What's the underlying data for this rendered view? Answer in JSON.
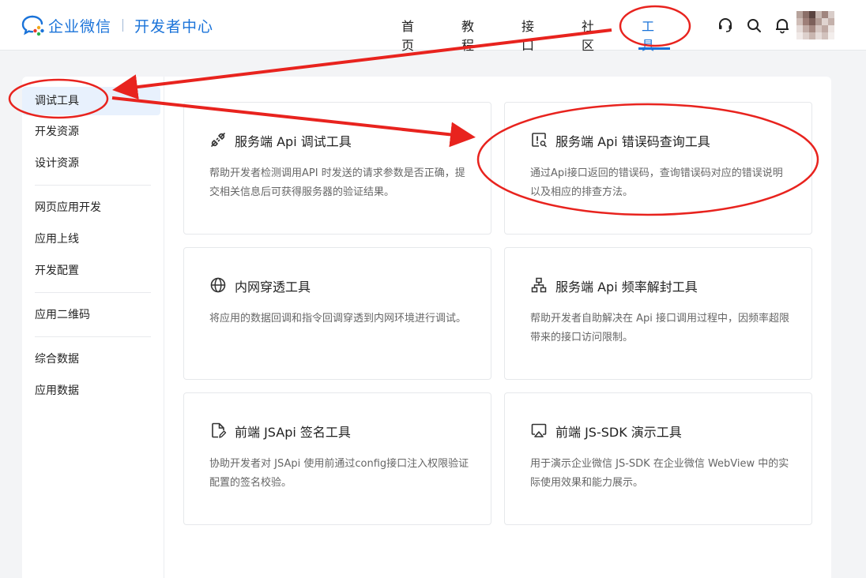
{
  "header": {
    "brand": "企业微信",
    "sub_brand": "开发者中心",
    "nav": [
      {
        "label": "首页"
      },
      {
        "label": "教程"
      },
      {
        "label": "接口"
      },
      {
        "label": "社区"
      },
      {
        "label": "工具",
        "active": true
      }
    ],
    "icons": [
      "headset-icon",
      "search-icon",
      "bell-icon"
    ],
    "accent_color": "#1a73d9"
  },
  "sidebar": {
    "items": [
      {
        "label": "调试工具",
        "active": true
      },
      {
        "label": "开发资源"
      },
      {
        "label": "设计资源"
      },
      {
        "label": "网页应用开发"
      },
      {
        "label": "应用上线"
      },
      {
        "label": "开发配置"
      },
      {
        "label": "应用二维码"
      },
      {
        "label": "综合数据"
      },
      {
        "label": "应用数据"
      }
    ]
  },
  "cards": [
    {
      "title": "服务端 Api 调试工具",
      "icon": "plug-icon",
      "desc": "帮助开发者检测调用API 时发送的请求参数是否正确，提交相关信息后可获得服务器的验证结果。"
    },
    {
      "title": "服务端 Api 错误码查询工具",
      "icon": "error-search-icon",
      "desc": "通过Api接口返回的错误码，查询错误码对应的错误说明以及相应的排查方法。"
    },
    {
      "title": "内网穿透工具",
      "icon": "globe-icon",
      "desc": "将应用的数据回调和指令回调穿透到内网环境进行调试。"
    },
    {
      "title": "服务端 Api 频率解封工具",
      "icon": "network-icon",
      "desc": "帮助开发者自助解决在 Api 接口调用过程中，因频率超限带来的接口访问限制。"
    },
    {
      "title": "前端 JSApi 签名工具",
      "icon": "document-sign-icon",
      "desc": "协助开发者对 JSApi 使用前通过config接口注入权限验证配置的签名校验。"
    },
    {
      "title": "前端 JS-SDK 演示工具",
      "icon": "airplay-icon",
      "desc": "用于演示企业微信 JS-SDK 在企业微信 WebView 中的实际使用效果和能力展示。"
    }
  ],
  "annotation_color": "#e8231e"
}
